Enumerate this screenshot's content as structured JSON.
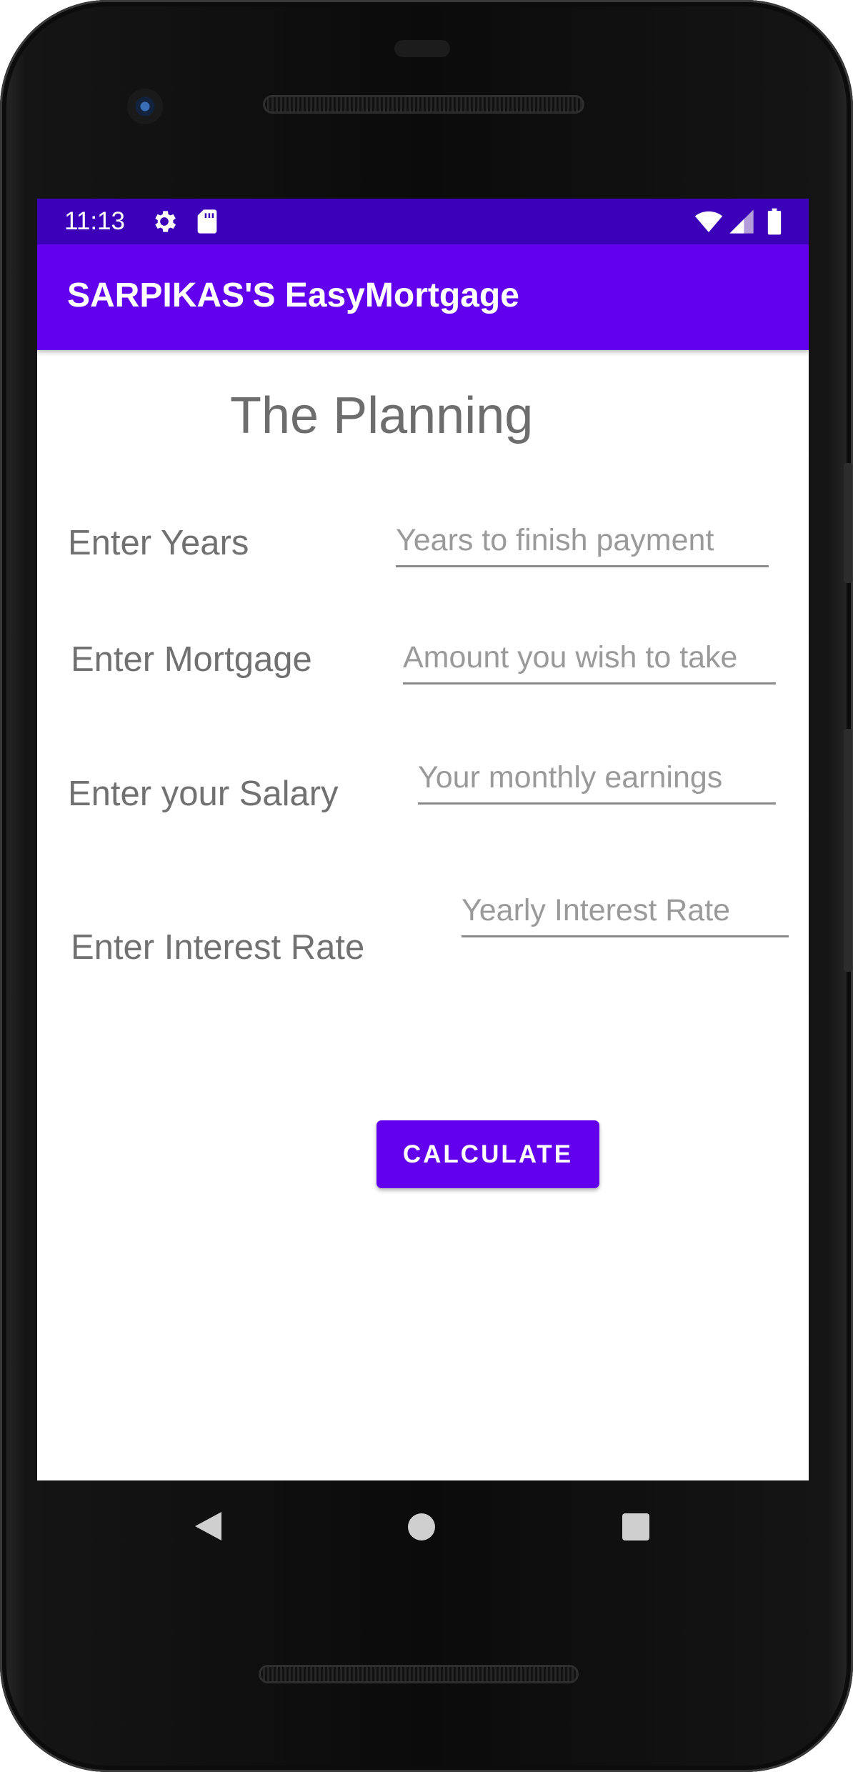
{
  "status_bar": {
    "time": "11:13",
    "icons": [
      "gear-icon",
      "sd-card-icon",
      "wifi-icon",
      "signal-icon",
      "battery-icon"
    ]
  },
  "app_bar": {
    "title": "SARPIKAS'S EasyMortgage"
  },
  "page": {
    "heading": "The Planning"
  },
  "form": {
    "years": {
      "label": "Enter Years",
      "placeholder": "Years to finish payment",
      "value": ""
    },
    "mortgage": {
      "label": "Enter Mortgage",
      "placeholder": "Amount you wish to take",
      "value": ""
    },
    "salary": {
      "label": "Enter your Salary",
      "placeholder": "Your monthly earnings",
      "value": ""
    },
    "interest": {
      "label": "Enter Interest Rate",
      "placeholder": "Yearly Interest Rate",
      "value": ""
    }
  },
  "actions": {
    "calculate_label": "CALCULATE"
  },
  "nav_bar": {
    "icons": [
      "back-icon",
      "home-icon",
      "recents-icon"
    ]
  },
  "colors": {
    "primary": "#6200ee",
    "primary_dark": "#3700b3",
    "text_secondary": "#717171"
  }
}
